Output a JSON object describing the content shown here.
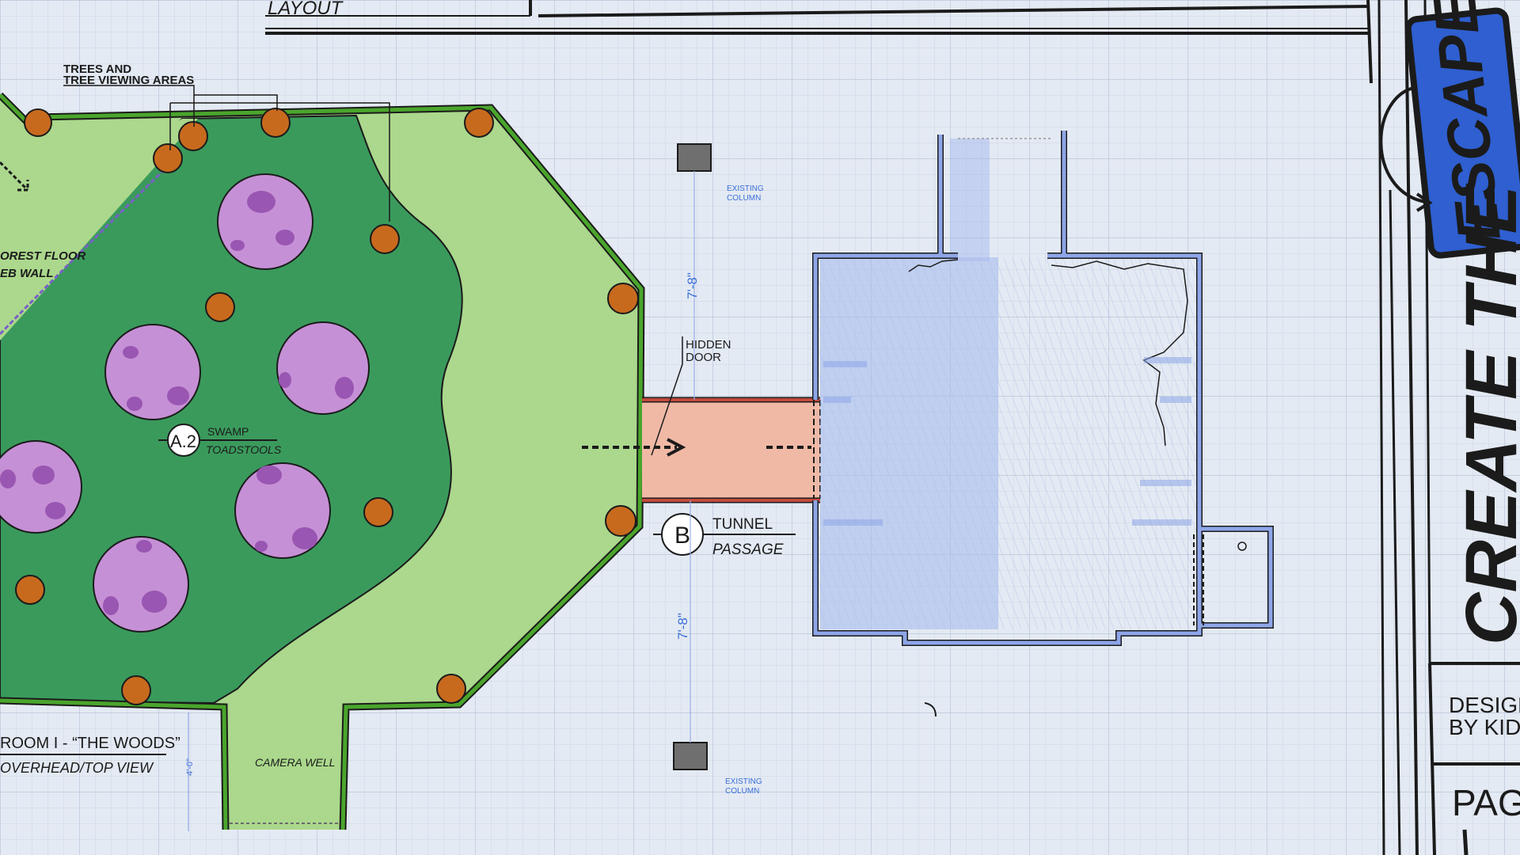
{
  "header": {
    "layout_label": "LAYOUT"
  },
  "sidebar": {
    "title_top": "ESCAPE",
    "title_main": "CREATE THE",
    "designed_by": [
      "DESIGNED",
      "BY KIDS"
    ],
    "page_label": "PAGE"
  },
  "room": {
    "title": "ROOM I - “THE WOODS”",
    "subtitle": "OVERHEAD/TOP VIEW"
  },
  "labels": {
    "trees_note": [
      "TREES AND",
      "TREE VIEWING AREAS"
    ],
    "forest_floor": [
      "OREST FLOOR",
      "EB WALL"
    ],
    "swamp_id": "A.2",
    "swamp_name": "SWAMP",
    "swamp_sub": "TOADSTOOLS",
    "tunnel_id": "B",
    "tunnel_name": "TUNNEL",
    "tunnel_sub": "PASSAGE",
    "hidden_door": [
      "HIDDEN",
      "DOOR"
    ],
    "existing_column_top": [
      "EXISTING",
      "COLUMN"
    ],
    "existing_column_bottom": [
      "EXISTING",
      "COLUMN"
    ],
    "dimension_top": "7'-8\"",
    "dimension_bottom": "7'-8\"",
    "dimension_small": "4'-0\"",
    "camera_well": "CAMERA WELL"
  },
  "colors": {
    "grid_bg": "#e4eaf3",
    "grid_line": "#c7d2e2",
    "outer_forest": "#a9d78a",
    "inner_swamp": "#3a9a5c",
    "wall_green": "#4aa52c",
    "toadstool": "#c690d6",
    "toadstool_spot": "#9956b2",
    "tree": "#c86a1e",
    "tunnel": "#f0b9a6",
    "tunnel_wall": "#c24a3c",
    "blue_room": "#a9bcec",
    "blue_wall": "#7f98e3",
    "escape_badge": "#2f5fd0",
    "column": "#6f6f6f"
  },
  "icons": {
    "arrow": "arrow-right-icon",
    "column": "square-column-icon"
  }
}
